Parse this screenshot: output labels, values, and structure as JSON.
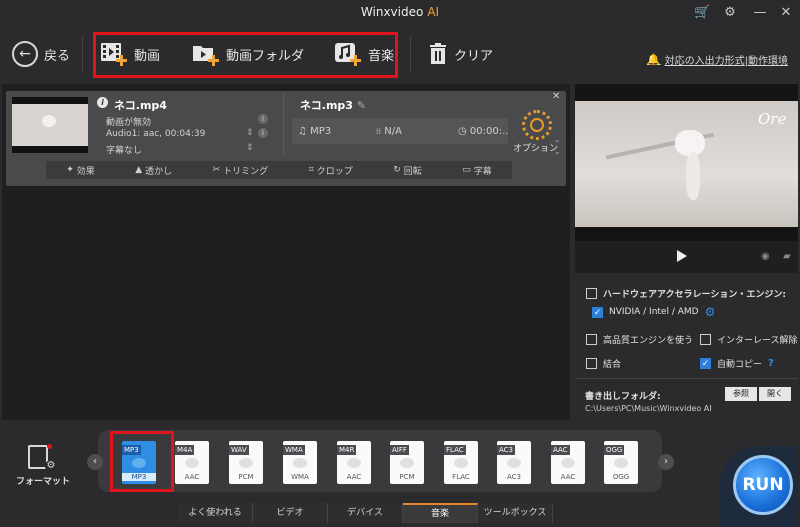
{
  "titlebar": {
    "title": "Winxvideo",
    "title_ai": "AI"
  },
  "toolbar": {
    "back_label": "戻る",
    "video_label": "動画",
    "folder_label": "動画フォルダ",
    "music_label": "音楽",
    "clear_label": "クリア",
    "notice_link": "対応の入出力形式|動作環境"
  },
  "file": {
    "source_name": "ネコ.mp4",
    "video_line": "動画が無効",
    "audio_line": "Audio1: aac, 00:04:39",
    "subtitle_line": "字幕なし",
    "output_name": "ネコ.mp3",
    "out_format": "MP3",
    "out_resolution": "N/A",
    "out_duration": "00:00:..",
    "option_label": "オプション"
  },
  "edit_bar": [
    {
      "label": "効果",
      "icon": "effect-icon"
    },
    {
      "label": "透かし",
      "icon": "watermark-icon"
    },
    {
      "label": "トリミング",
      "icon": "scissors-icon"
    },
    {
      "label": "クロップ",
      "icon": "crop-icon"
    },
    {
      "label": "回転",
      "icon": "rotate-icon"
    },
    {
      "label": "字幕",
      "icon": "subtitle-icon"
    }
  ],
  "preview": {
    "watermark_text": "Ore"
  },
  "settings": {
    "hw_accel_label": "ハードウェアアクセラレーション・エンジン:",
    "nvidia_label": "NVIDIA / Intel / AMD",
    "hq_engine_label": "高品質エンジンを使う",
    "deinterlace_label": "インターレース解除",
    "merge_label": "結合",
    "autocopy_label": "自動コピー",
    "help_mark": "?",
    "output_folder_label": "書き出しフォルダ:",
    "output_folder_path": "C:\\Users\\PC\\Music\\Winxvideo AI",
    "browse_label": "参照",
    "open_label": "開く"
  },
  "formats": [
    {
      "tag": "MP3",
      "sub": "MP3",
      "selected": true
    },
    {
      "tag": "M4A",
      "sub": "AAC"
    },
    {
      "tag": "WAV",
      "sub": "PCM"
    },
    {
      "tag": "WMA",
      "sub": "WMA"
    },
    {
      "tag": "M4R",
      "sub": "AAC"
    },
    {
      "tag": "AIFF",
      "sub": "PCM"
    },
    {
      "tag": "FLAC",
      "sub": "FLAC"
    },
    {
      "tag": "AC3",
      "sub": "AC3"
    },
    {
      "tag": "AAC",
      "sub": "AAC"
    },
    {
      "tag": "OGG",
      "sub": "OGG"
    }
  ],
  "format_panel_label": "フォーマット",
  "tabs": [
    {
      "label": "よく使われる"
    },
    {
      "label": "ビデオ"
    },
    {
      "label": "デバイス"
    },
    {
      "label": "音楽",
      "active": true
    },
    {
      "label": "ツールボックス"
    }
  ],
  "run_label": "RUN",
  "colors": {
    "accent": "#e6862c",
    "highlight": "#e0141b",
    "selected_format": "#2e8ee3",
    "run": "#1a6fd8"
  }
}
